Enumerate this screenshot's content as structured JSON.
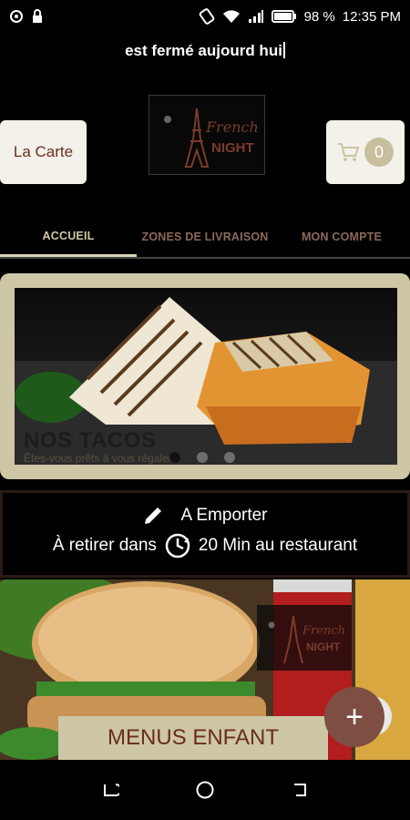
{
  "status_bar": {
    "battery": "98 %",
    "time": "12:35 PM"
  },
  "notice": "est fermé aujourd hui",
  "header": {
    "carte_label": "La Carte",
    "cart_count": "0",
    "logo_text_1": "French",
    "logo_text_2": "NIGHT"
  },
  "tabs": [
    {
      "label": "ACCUEIL",
      "active": true
    },
    {
      "label": "ZONES DE LIVRAISON",
      "active": false
    },
    {
      "label": "MON COMPTE",
      "active": false
    }
  ],
  "banner": {
    "title": "NOS TACOS",
    "subtitle": "Êtes-vous prêts à vous régaler ?",
    "slide_index": 1,
    "slide_count": 3
  },
  "pickup": {
    "mode": "A Emporter",
    "prefix": "À retirer dans",
    "suffix": "20 Min au restaurant"
  },
  "menu_card": {
    "label": "MENUS ENFANT"
  },
  "colors": {
    "accent_beige": "#cdc7a6",
    "brown_text": "#6a2d1e",
    "fab": "#7e4e42"
  }
}
